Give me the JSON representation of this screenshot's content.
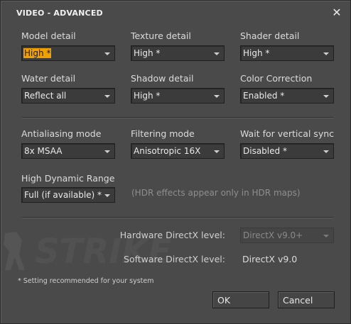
{
  "dialog": {
    "title": "VIDEO - ADVANCED",
    "close_glyph": "✕"
  },
  "fields": {
    "model_detail": {
      "label": "Model detail",
      "value": "High *"
    },
    "texture_detail": {
      "label": "Texture detail",
      "value": "High *"
    },
    "shader_detail": {
      "label": "Shader detail",
      "value": "High *"
    },
    "water_detail": {
      "label": "Water detail",
      "value": "Reflect all"
    },
    "shadow_detail": {
      "label": "Shadow detail",
      "value": "High *"
    },
    "color_correction": {
      "label": "Color Correction",
      "value": "Enabled *"
    },
    "antialiasing_mode": {
      "label": "Antialiasing mode",
      "value": "8x MSAA"
    },
    "filtering_mode": {
      "label": "Filtering mode",
      "value": "Anisotropic 16X"
    },
    "vsync": {
      "label": "Wait for vertical sync",
      "value": "Disabled *"
    },
    "hdr": {
      "label": "High Dynamic Range",
      "value": "Full (if available) *"
    }
  },
  "hdr_note": "(HDR effects appear only in HDR maps)",
  "directx": {
    "hardware_label": "Hardware DirectX level:",
    "hardware_value": "DirectX v9.0+",
    "software_label": "Software DirectX level:",
    "software_value": "DirectX v9.0"
  },
  "footnote": "* Setting recommended for your system",
  "buttons": {
    "ok": "OK",
    "cancel": "Cancel"
  },
  "watermark_text": "STRIKE",
  "colors": {
    "dialog_bg": "#4a4a4a",
    "selection": "#f2a000"
  }
}
